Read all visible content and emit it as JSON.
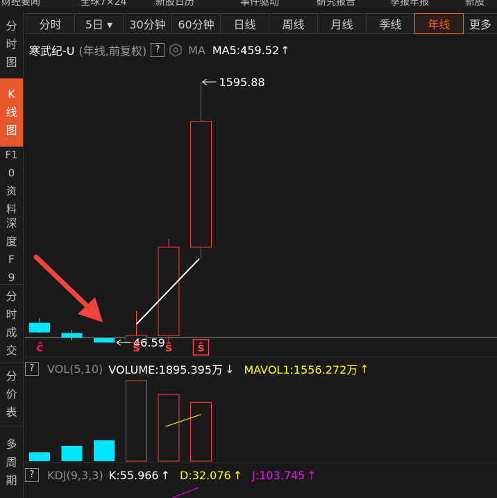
{
  "top_nav": [
    "财经要闻",
    "全球7×24",
    "新股日历",
    "事件驱动",
    "研究报告",
    "季报年报",
    "新股"
  ],
  "sidebar": [
    {
      "label": "分时图",
      "active": false
    },
    {
      "label": "K线图",
      "active": true
    },
    {
      "label": "F10资料",
      "active": false
    },
    {
      "label": "深度F9",
      "active": false
    },
    {
      "label": "分时成交",
      "active": false
    },
    {
      "label": "分价表",
      "active": false
    },
    {
      "label": "多周期",
      "active": false
    }
  ],
  "tabs": [
    {
      "label": "分时",
      "active": false
    },
    {
      "label": "5日 ▾",
      "active": false
    },
    {
      "label": "30分钟",
      "active": false
    },
    {
      "label": "60分钟",
      "active": false
    },
    {
      "label": "日线",
      "active": false
    },
    {
      "label": "周线",
      "active": false
    },
    {
      "label": "月线",
      "active": false
    },
    {
      "label": "季线",
      "active": false
    },
    {
      "label": "年线",
      "active": true
    },
    {
      "label": "更多",
      "active": false
    }
  ],
  "chart_header": {
    "stock_name": "寒武纪-U",
    "mode": "(年线,前复权)",
    "help": "?",
    "ma_label": "MA",
    "ma5": "MA5:459.52",
    "ma5_arrow": "↑"
  },
  "vol_header": {
    "help": "?",
    "indicator": "VOL(5,10)",
    "volume": "VOLUME:1895.395万",
    "volume_arrow": "↓",
    "mavol": "MAVOL1:1556.272万",
    "mavol_arrow": "↑"
  },
  "kdj_header": {
    "help": "?",
    "indicator": "KDJ(9,3,3)",
    "k": "K:55.966",
    "k_arrow": "↑",
    "d": "D:32.076",
    "d_arrow": "↑",
    "j": "J:103.745",
    "j_arrow": "↑"
  },
  "annotations": {
    "high": "1595.88",
    "low": "46.59"
  },
  "colors": {
    "up": "#ff3b3b",
    "down": "#00e5ff",
    "accent": "#ff5a28",
    "ma5": "#ffffff",
    "mavol": "#ffff00",
    "kdj_j": "#ff00ff",
    "markers": "#e8174f"
  },
  "chart_data": {
    "type": "candlestick",
    "candles": [
      {
        "dir": "down",
        "open": 133,
        "close": 46,
        "high": 175,
        "low": 40
      },
      {
        "dir": "down",
        "open": 41,
        "close": 0,
        "high": 69,
        "low": -26
      },
      {
        "dir": "down",
        "open": -6,
        "close": -45,
        "high": -6,
        "low": -45
      },
      {
        "dir": "up",
        "open": -45,
        "close": 17,
        "high": 240,
        "low": -77
      },
      {
        "dir": "up",
        "open": 17,
        "close": 813,
        "high": 886,
        "low": -45
      },
      {
        "dir": "up",
        "open": 813,
        "close": 1945,
        "high": 2300,
        "low": 710
      }
    ],
    "ma5": [
      [
        3,
        120
      ],
      [
        4.95,
        710
      ]
    ],
    "volume": [
      {
        "dir": "down",
        "value": 0.11
      },
      {
        "dir": "down",
        "value": 0.19
      },
      {
        "dir": "down",
        "value": 0.26
      },
      {
        "dir": "up",
        "value": 1.0
      },
      {
        "dir": "up",
        "value": 0.83
      },
      {
        "dir": "up",
        "value": 0.73
      }
    ],
    "mavol": [
      [
        3.9,
        0.43
      ],
      [
        5,
        0.58
      ]
    ],
    "markers": [
      {
        "index": 0,
        "symbol": "ĉ"
      },
      {
        "index": 3,
        "symbol": "ŝ"
      },
      {
        "index": 4,
        "symbol": "ŝ"
      },
      {
        "index": 5,
        "symbol": "ŝ"
      }
    ]
  }
}
